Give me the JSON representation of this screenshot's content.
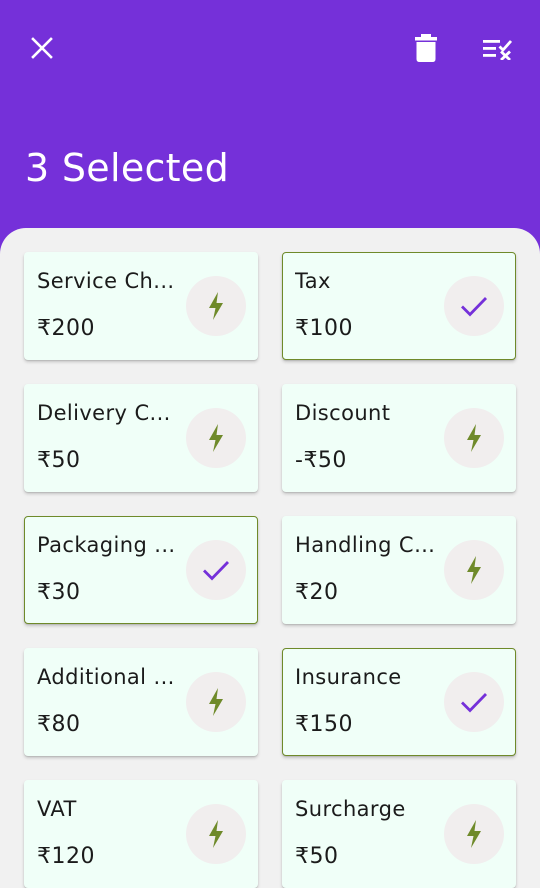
{
  "header": {
    "title": "3 Selected",
    "colors": {
      "appbar": "#7530d9",
      "icon": "#ffffff"
    }
  },
  "items": [
    {
      "name": "Service Ch...",
      "amount": "₹200",
      "selected": false
    },
    {
      "name": "Tax",
      "amount": "₹100",
      "selected": true
    },
    {
      "name": "Delivery C...",
      "amount": "₹50",
      "selected": false
    },
    {
      "name": "Discount",
      "amount": "-₹50",
      "selected": false
    },
    {
      "name": "Packaging ...",
      "amount": "₹30",
      "selected": true
    },
    {
      "name": "Handling C...",
      "amount": "₹20",
      "selected": false
    },
    {
      "name": "Additional ...",
      "amount": "₹80",
      "selected": false
    },
    {
      "name": "Insurance",
      "amount": "₹150",
      "selected": true
    },
    {
      "name": "VAT",
      "amount": "₹120",
      "selected": false
    },
    {
      "name": "Surcharge",
      "amount": "₹50",
      "selected": false
    }
  ],
  "icons": {
    "unselected": "lightning-bolt-icon",
    "selected": "check-icon"
  },
  "colors": {
    "card_bg": "#f0fff8",
    "selected_border": "#6f8a2a",
    "bolt": "#6f8a2a",
    "check": "#7530d9",
    "sheet_bg": "#f1f1f1"
  }
}
